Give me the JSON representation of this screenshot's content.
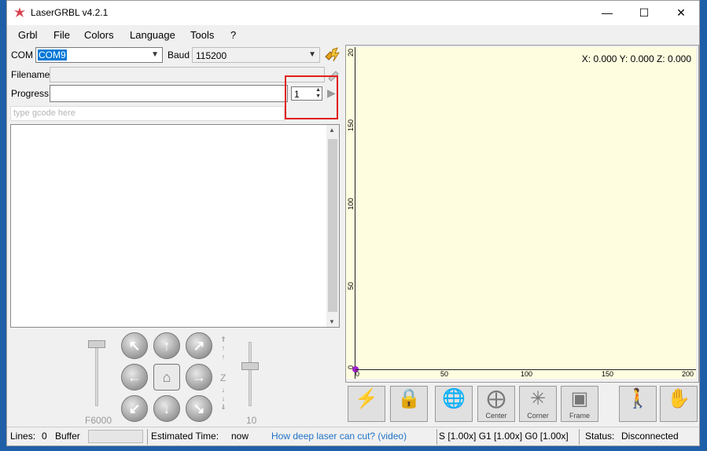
{
  "window": {
    "title": "LaserGRBL v4.2.1",
    "minimize_icon": "—",
    "maximize_icon": "☐",
    "close_icon": "✕"
  },
  "menu": [
    "Grbl",
    "File",
    "Colors",
    "Language",
    "Tools",
    "?"
  ],
  "connection": {
    "com_label": "COM",
    "com_value": "COM9",
    "baud_label": "Baud",
    "baud_value": "115200"
  },
  "file": {
    "filename_label": "Filename",
    "progress_label": "Progress",
    "passes_value": "1"
  },
  "gcode_input": {
    "placeholder": "type gcode here"
  },
  "jog": {
    "feed_label": "F6000",
    "step_label": "10",
    "z_label": "Z"
  },
  "preview": {
    "coords_text": "X: 0.000 Y: 0.000 Z: 0.000",
    "y_ticks": [
      "0",
      "50",
      "100",
      "150",
      "20"
    ],
    "x_ticks": [
      "0",
      "50",
      "100",
      "150",
      "200"
    ]
  },
  "toolbar": {
    "center_label": "Center",
    "corner_label": "Corner",
    "frame_label": "Frame"
  },
  "status": {
    "lines_label": "Lines:",
    "lines_value": "0",
    "buffer_label": "Buffer",
    "estimated_label": "Estimated Time:",
    "estimated_value": "now",
    "help_link": "How deep laser can cut? (video)",
    "overrides": "S [1.00x] G1 [1.00x] G0 [1.00x]",
    "status_label": "Status:",
    "status_value": "Disconnected"
  },
  "colors": {
    "accent": "#0078d7",
    "canvas_bg": "#fffde0",
    "highlight": "#e0201a",
    "link": "#1e73c8"
  }
}
